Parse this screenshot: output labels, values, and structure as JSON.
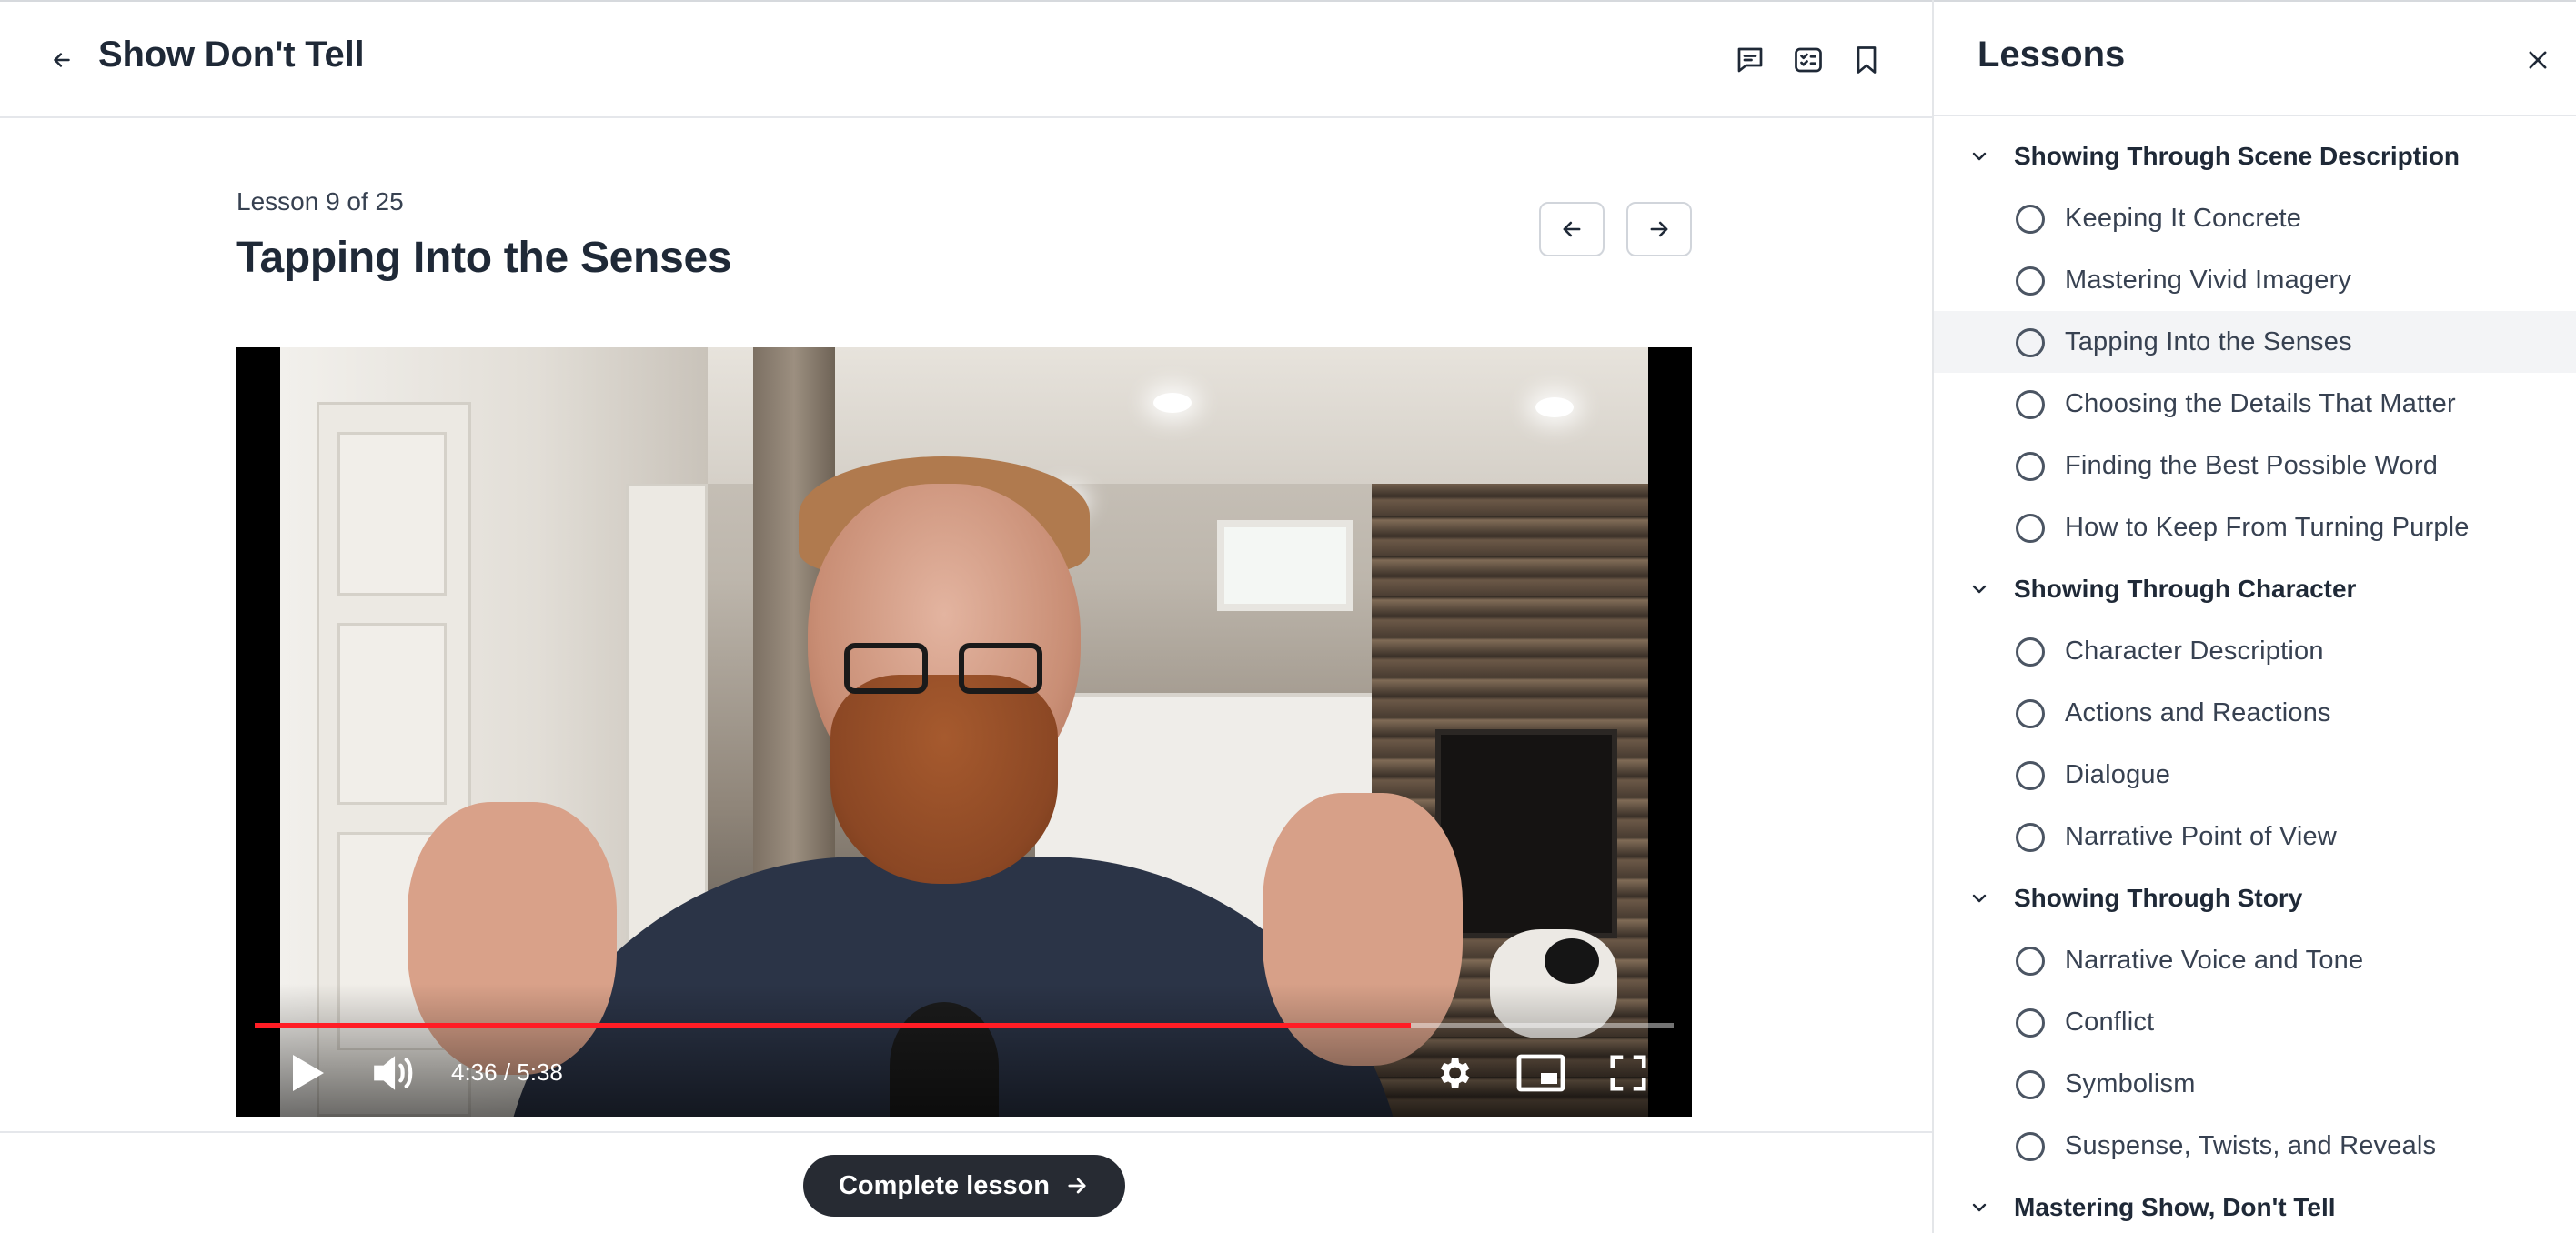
{
  "header": {
    "back_icon": "arrow-left-icon",
    "course_title": "Show Don't Tell",
    "icons": [
      "comment-icon",
      "checklist-icon",
      "bookmark-icon"
    ]
  },
  "lesson": {
    "counter": "Lesson 9 of 25",
    "title": "Tapping Into the Senses",
    "prev_icon": "arrow-left-icon",
    "next_icon": "arrow-right-icon"
  },
  "video": {
    "timecode": "4:36 / 5:38",
    "progress": 0.815,
    "progress_color": "#ff1d25",
    "controls": [
      "play-icon",
      "volume-icon",
      "settings-icon",
      "miniplayer-icon",
      "fullscreen-icon"
    ]
  },
  "footer": {
    "complete_label": "Complete lesson",
    "complete_icon": "arrow-right-icon"
  },
  "sidebar": {
    "title": "Lessons",
    "close_icon": "close-icon",
    "sections": [
      {
        "label": "Showing Through Scene Description",
        "lessons": [
          {
            "label": "Keeping It Concrete"
          },
          {
            "label": "Mastering Vivid Imagery"
          },
          {
            "label": "Tapping Into the Senses",
            "active": true
          },
          {
            "label": "Choosing the Details That Matter"
          },
          {
            "label": "Finding the Best Possible Word"
          },
          {
            "label": "How to Keep From Turning Purple"
          }
        ]
      },
      {
        "label": "Showing Through Character",
        "lessons": [
          {
            "label": "Character Description"
          },
          {
            "label": "Actions and Reactions"
          },
          {
            "label": "Dialogue"
          },
          {
            "label": "Narrative Point of View"
          }
        ]
      },
      {
        "label": "Showing Through Story",
        "lessons": [
          {
            "label": "Narrative Voice and Tone"
          },
          {
            "label": "Conflict"
          },
          {
            "label": "Symbolism"
          },
          {
            "label": "Suspense, Twists, and Reveals"
          }
        ]
      },
      {
        "label": "Mastering Show, Don't Tell",
        "lessons": []
      }
    ]
  },
  "colors": {
    "text_primary": "#1f2937",
    "button_dark": "#272b33",
    "active_row": "#f3f4f6",
    "border": "#e5e7eb"
  }
}
